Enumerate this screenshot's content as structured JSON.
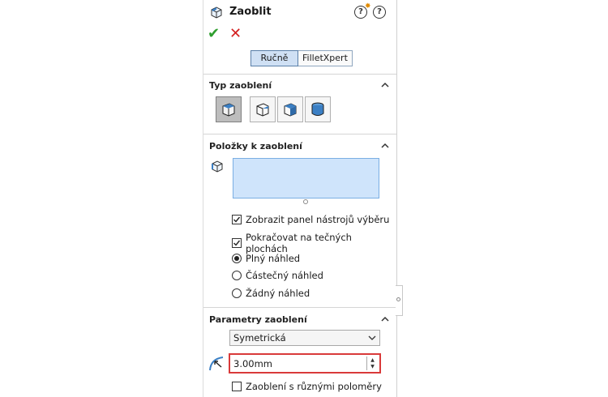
{
  "header": {
    "title": "Zaoblit"
  },
  "mode_tabs": [
    {
      "label": "Ručně",
      "active": true
    },
    {
      "label": "FilletXpert",
      "active": false
    }
  ],
  "sections": {
    "type": {
      "title": "Typ zaoblení",
      "buttons": [
        "constant-size-fillet",
        "variable-size-fillet",
        "face-fillet",
        "full-round-fillet"
      ],
      "active_index": 0
    },
    "items": {
      "title": "Položky k zaoblení",
      "checkboxes": [
        {
          "label": "Zobrazit panel nástrojů výběru",
          "checked": true
        },
        {
          "label": "Pokračovat na tečných plochách",
          "checked": true
        }
      ],
      "radios": [
        {
          "label": "Plný náhled",
          "selected": true
        },
        {
          "label": "Částečný náhled",
          "selected": false
        },
        {
          "label": "Žádný náhled",
          "selected": false
        }
      ]
    },
    "params": {
      "title": "Parametry zaoblení",
      "method": "Symetrická",
      "radius": "3.00mm",
      "multi_radius_label": "Zaoblení s různými poloměry",
      "multi_radius_checked": false
    }
  },
  "colors": {
    "accent_blue": "#3b7fc4",
    "selection_box": "#cfe4fb",
    "highlight_red": "#d93a3a",
    "ok_green": "#2e9e2e",
    "cancel_red": "#d42020"
  }
}
